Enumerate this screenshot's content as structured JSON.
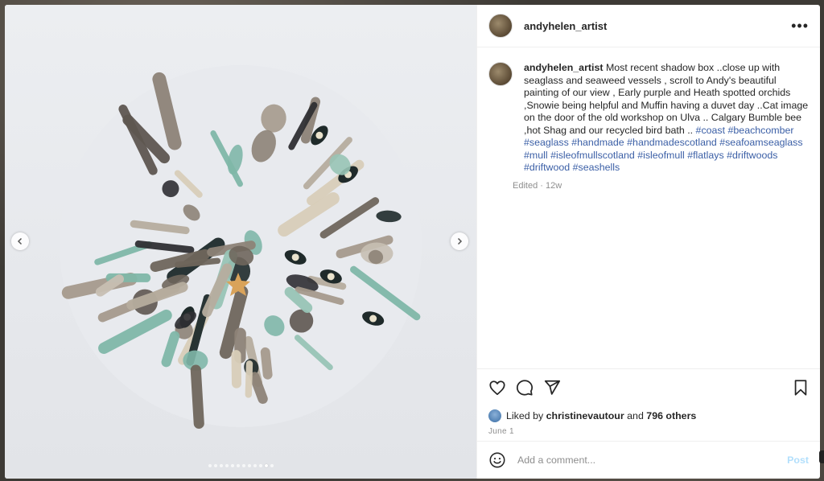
{
  "post": {
    "username": "andyhelen_artist",
    "more_icon": "more-horizontal-icon",
    "caption_text": "Most recent shadow box ..close up with seaglass and seaweed vessels , scroll to Andy's beautiful painting of our view , Early purple and Heath spotted orchids ,Snowie being helpful and Muffin having a duvet day ..Cat image on the door of the old workshop on Ulva .. Calgary Bumble bee ,hot Shag and our recycled bird bath ..",
    "hashtags": [
      "#coast",
      "#beachcomber",
      "#seaglass",
      "#handmade",
      "#handmadescotland",
      "#seafoamseaglass",
      "#mull",
      "#isleofmullscotland",
      "#isleofmull",
      "#flatlays",
      "#driftwoods",
      "#driftwood",
      "#seashells"
    ],
    "edited_label": "Edited",
    "age": "12w",
    "liked_by_label": "Liked by",
    "liked_by_user": "christinevautour",
    "and_label": "and",
    "others_count": "796 others",
    "date": "June 1"
  },
  "comment_box": {
    "placeholder": "Add a comment...",
    "post_label": "Post"
  },
  "carousel": {
    "slide_count": 12,
    "active_index": 10
  },
  "colors": {
    "link": "#3b5fa6",
    "post_disabled": "#b2dffc"
  }
}
